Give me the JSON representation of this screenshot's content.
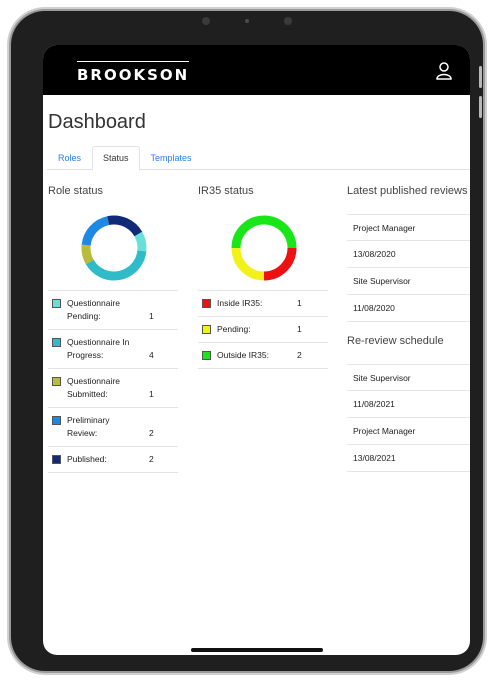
{
  "header": {
    "logo_text": "BROOKSON",
    "user_icon": "user-icon"
  },
  "page": {
    "title": "Dashboard"
  },
  "tabs": [
    {
      "label": "Roles"
    },
    {
      "label": "Status"
    },
    {
      "label": "Templates"
    }
  ],
  "role_status": {
    "title": "Role status",
    "items": [
      {
        "label": "Questionnaire Pending:",
        "count": "1",
        "color": "#66e0d8"
      },
      {
        "label": "Questionnaire In Progress:",
        "count": "4",
        "color": "#2fbcc8"
      },
      {
        "label": "Questionnaire Submitted:",
        "count": "1",
        "color": "#b9bb3b"
      },
      {
        "label": "Preliminary Review:",
        "count": "2",
        "color": "#1e88e5"
      },
      {
        "label": "Published:",
        "count": "2",
        "color": "#102a78"
      }
    ]
  },
  "ir35_status": {
    "title": "IR35 status",
    "items": [
      {
        "label": "Inside IR35:",
        "count": "1",
        "color": "#ee1111"
      },
      {
        "label": "Pending:",
        "count": "1",
        "color": "#f2f21a"
      },
      {
        "label": "Outside IR35:",
        "count": "2",
        "color": "#19e619"
      }
    ]
  },
  "latest_reviews": {
    "title": "Latest published reviews",
    "rows": [
      "Project Manager",
      "13/08/2020",
      "Site Supervisor",
      "11/08/2020"
    ]
  },
  "re_review": {
    "title": "Re-review schedule",
    "rows": [
      "Site Supervisor",
      "11/08/2021",
      "Project Manager",
      "13/08/2021"
    ]
  }
}
